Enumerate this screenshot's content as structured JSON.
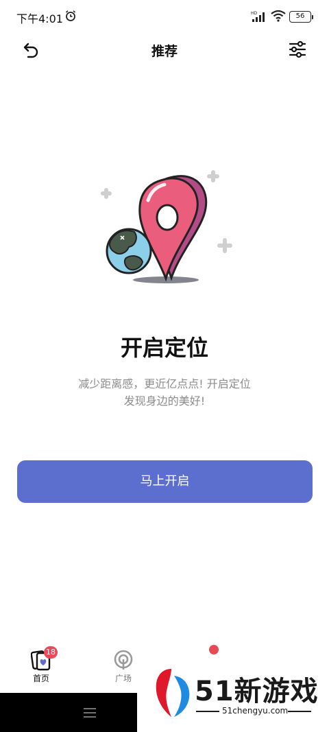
{
  "status_bar": {
    "time": "下午4:01",
    "network_label": "HD",
    "battery": "56",
    "icons": [
      "alarm-icon",
      "signal-icon",
      "wifi-icon",
      "battery-icon"
    ]
  },
  "header": {
    "title": "推荐",
    "left_icon": "back-icon",
    "right_icon": "filter-icon"
  },
  "main": {
    "illustration": "location-pin-globe-illustration",
    "heading": "开启定位",
    "description_line1": "减少距离感，更近亿点点! 开启定位",
    "description_line2": "发现身边的美好!",
    "button_label": "马上开启"
  },
  "tabs": [
    {
      "label": "首页",
      "badge": "18",
      "icon": "cards-heart-icon",
      "active": true
    },
    {
      "label": "广场",
      "icon": "broadcast-icon",
      "active": false
    }
  ],
  "watermark": {
    "brand": "51新游戏",
    "url": "51chengyu.com"
  },
  "colors": {
    "accent": "#5c6fcf",
    "badge": "#e94a58",
    "pin": "#ea5d7c",
    "pin_shadow": "#b34b86",
    "globe_sea": "#8ccfe8",
    "globe_land": "#4a5a4a"
  }
}
